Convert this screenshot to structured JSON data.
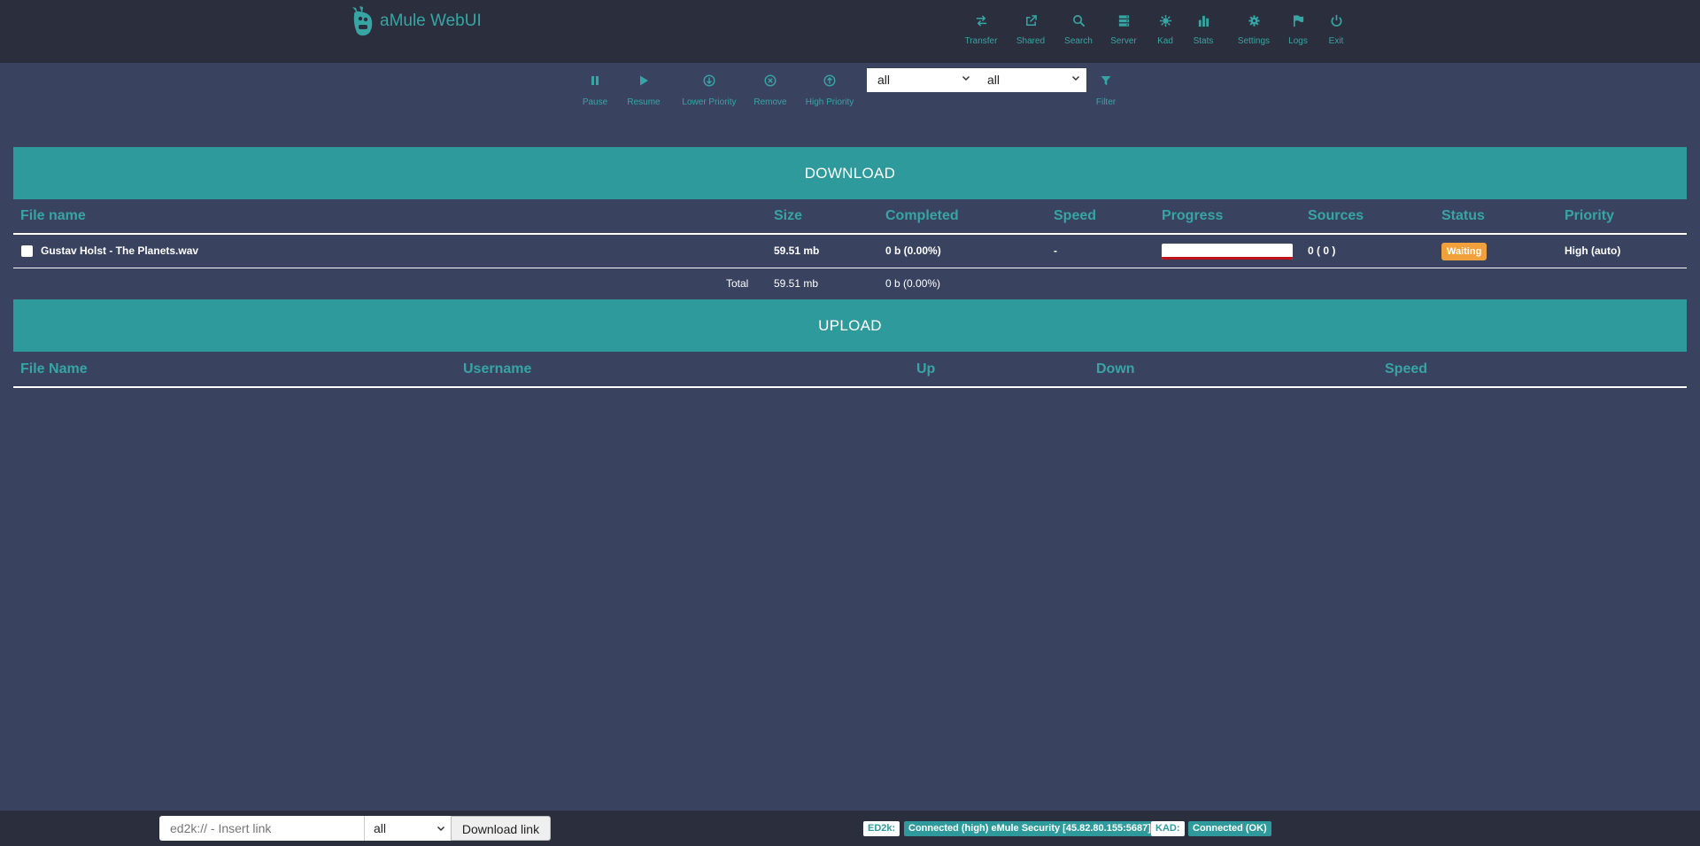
{
  "header": {
    "app_title": "aMule WebUI",
    "nav": [
      {
        "label": "Transfer",
        "icon": "transfer-icon"
      },
      {
        "label": "Shared",
        "icon": "share-icon"
      },
      {
        "label": "Search",
        "icon": "search-icon"
      },
      {
        "label": "Server",
        "icon": "server-icon"
      },
      {
        "label": "Kad",
        "icon": "kad-icon"
      },
      {
        "label": "Stats",
        "icon": "stats-icon"
      },
      {
        "label": "Settings",
        "icon": "gear-icon"
      },
      {
        "label": "Logs",
        "icon": "flag-icon"
      },
      {
        "label": "Exit",
        "icon": "power-icon"
      }
    ]
  },
  "toolbar": {
    "actions": [
      {
        "label": "Pause",
        "icon": "pause-icon"
      },
      {
        "label": "Resume",
        "icon": "play-icon"
      },
      {
        "label": "Lower Priority",
        "icon": "arrow-down-circle-icon"
      },
      {
        "label": "Remove",
        "icon": "x-circle-icon"
      },
      {
        "label": "High Priority",
        "icon": "arrow-up-circle-icon"
      }
    ],
    "filter_category": "all",
    "filter_status": "all",
    "filter_label": "Filter"
  },
  "download": {
    "title": "DOWNLOAD",
    "columns": [
      "File name",
      "Size",
      "Completed",
      "Speed",
      "Progress",
      "Sources",
      "Status",
      "Priority"
    ],
    "rows": [
      {
        "file_name": "Gustav Holst - The Planets.wav",
        "size": "59.51 mb",
        "completed": "0 b (0.00%)",
        "speed": "-",
        "progress": 0.0,
        "sources": "0 ( 0 )",
        "status": "Waiting",
        "priority": "High (auto)"
      }
    ],
    "total": {
      "label": "Total",
      "size": "59.51 mb",
      "completed": "0 b (0.00%)"
    }
  },
  "upload": {
    "title": "UPLOAD",
    "columns": [
      "File Name",
      "Username",
      "Up",
      "Down",
      "Speed"
    ]
  },
  "footer": {
    "link_placeholder": "ed2k:// - Insert link",
    "link_category": "all",
    "download_button": "Download link",
    "ed2k_label": "ED2k:",
    "ed2k_status": "Connected (high) eMule Security [45.82.80.155:5687]",
    "kad_label": "KAD:",
    "kad_status": "Connected (OK)"
  },
  "colors": {
    "accent": "#36a5a3",
    "section_bar": "#2e9a9b",
    "background": "#394360",
    "header_bg": "#2b2f3d",
    "status_waiting": "#f0a13b",
    "progress_bar": "#c0121b"
  }
}
